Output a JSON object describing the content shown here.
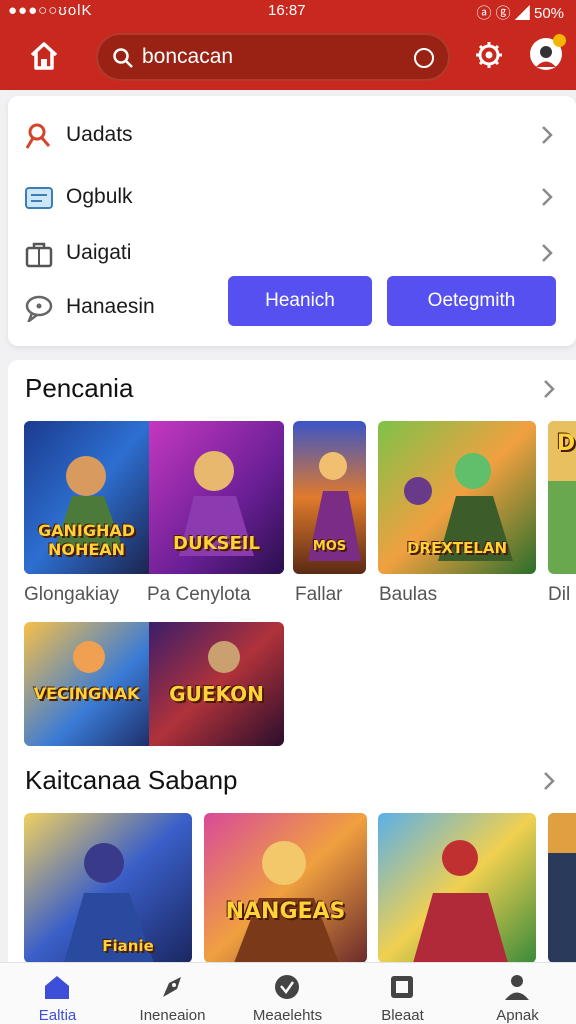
{
  "status_bar": {
    "left": "●●●○○ʊolK",
    "time": "16:87",
    "right": "ⓐ ⓖ ◢ 50%"
  },
  "header": {
    "search": {
      "value": "boncacan"
    }
  },
  "menu": {
    "items": [
      {
        "label": "Uadats",
        "icon": "search-user-icon"
      },
      {
        "label": "Ogbulk",
        "icon": "card-icon"
      },
      {
        "label": "Uaigati",
        "icon": "briefcase-icon"
      },
      {
        "label": "Hanaesin",
        "icon": "chat-icon"
      }
    ],
    "button_1": "Heanich",
    "button_2": "Oetegmith"
  },
  "sections": [
    {
      "title": "Pencania",
      "tiles": [
        {
          "caption": "Glongakiay",
          "art_text": "GANIGHAD NOHEAN"
        },
        {
          "caption": "Pa Cenylota",
          "art_text": "DUKSEIL"
        },
        {
          "caption": "Fallar",
          "art_text": "MOS"
        },
        {
          "caption": "Baulas",
          "art_text": "DREXTELAN"
        },
        {
          "caption": "Dil",
          "art_text": "D"
        }
      ],
      "row2_tiles": [
        {
          "art_text": "VECINGNAK"
        },
        {
          "art_text": "GUEKON"
        }
      ]
    },
    {
      "title": "Kaitcanaa Sabanp",
      "tiles": [
        {
          "art_text": "Fianie"
        },
        {
          "art_text": "NANGEAS"
        },
        {
          "art_text": ""
        },
        {
          "art_text": ""
        }
      ]
    }
  ],
  "bottom_nav": [
    {
      "label": "Ealtia",
      "icon": "home-icon"
    },
    {
      "label": "Ineneaion",
      "icon": "rocket-icon"
    },
    {
      "label": "Meaelehts",
      "icon": "check-circle-icon"
    },
    {
      "label": "Bleaat",
      "icon": "square-icon"
    },
    {
      "label": "Apnak",
      "icon": "person-icon"
    }
  ],
  "colors": {
    "header": "#c9281e",
    "accent": "#5650f0",
    "active_nav": "#3d4fd8"
  }
}
